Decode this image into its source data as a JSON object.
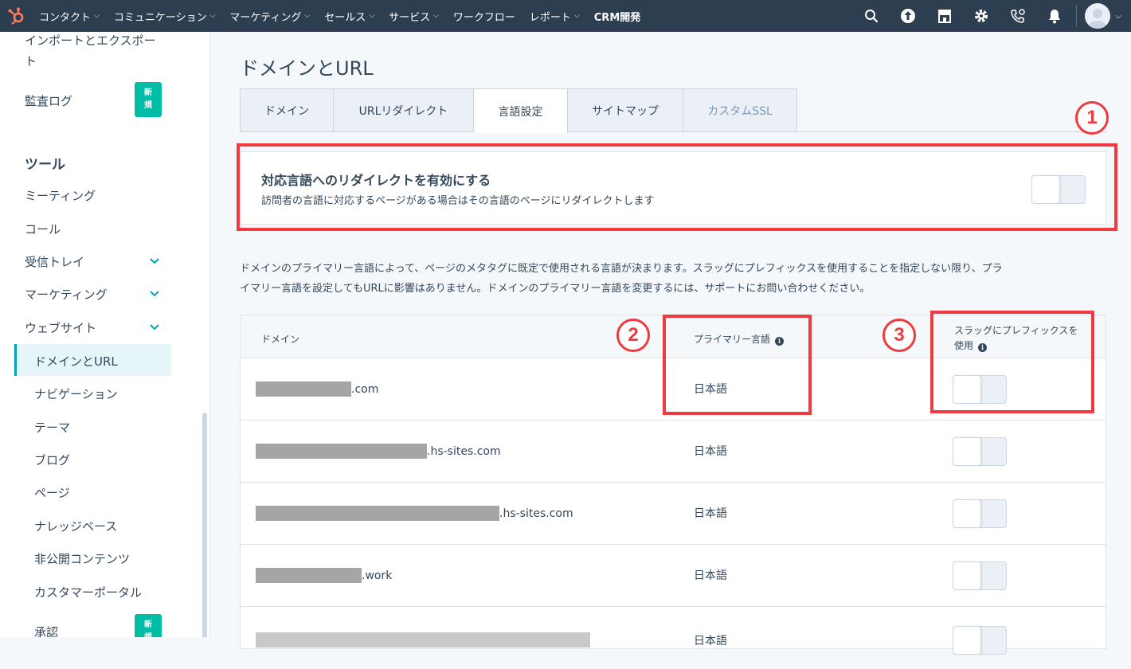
{
  "topnav": {
    "menu": [
      {
        "label": "コンタクト",
        "chevron": true
      },
      {
        "label": "コミュニケーション",
        "chevron": true
      },
      {
        "label": "マーケティング",
        "chevron": true
      },
      {
        "label": "セールス",
        "chevron": true
      },
      {
        "label": "サービス",
        "chevron": true
      },
      {
        "label": "ワークフロー",
        "chevron": false
      },
      {
        "label": "レポート",
        "chevron": true
      }
    ],
    "crm_label": "CRM開発",
    "icons": [
      "search-icon",
      "upgrade-icon",
      "marketplace-icon",
      "settings-icon",
      "calling-icon",
      "notifications-icon"
    ]
  },
  "sidebar": {
    "import_export_line1": "インポートとエクスポー",
    "import_export_line2": "ト",
    "audit_log": "監査ログ",
    "new_badge_1": "新",
    "new_badge_2": "規",
    "tools_heading": "ツール",
    "meetings": "ミーティング",
    "calls": "コール",
    "inbox": "受信トレイ",
    "marketing": "マーケティング",
    "website": "ウェブサイト",
    "domains_urls": "ドメインとURL",
    "navigation": "ナビゲーション",
    "themes": "テーマ",
    "blog": "ブログ",
    "pages": "ページ",
    "knowledge_base": "ナレッジベース",
    "private_content": "非公開コンテンツ",
    "customer_portal": "カスタマーポータル",
    "approvals": "承認"
  },
  "main": {
    "title": "ドメインとURL",
    "tabs": [
      {
        "label": "ドメイン"
      },
      {
        "label": "URLリダイレクト"
      },
      {
        "label": "言語設定"
      },
      {
        "label": "サイトマップ"
      },
      {
        "label": "カスタムSSL"
      }
    ],
    "redirect": {
      "title": "対応言語へのリダイレクトを有効にする",
      "description": "訪問者の言語に対応するページがある場合はその言語のページにリダイレクトします",
      "enabled": false
    },
    "info_line1": "ドメインのプライマリー言語によって、ページのメタタグに既定で使用される言語が決まります。スラッグにプレフィックスを使用することを指定しない限り、プラ",
    "info_line2": "イマリー言語を設定してもURLに影響はありません。ドメインのプライマリー言語を変更するには、サポートにお問い合わせください。",
    "table": {
      "col_domain": "ドメイン",
      "col_primary_language": "プライマリー言語",
      "col_prefix_line1": "スラッグにプレフィックスを",
      "col_prefix_line2": "使用",
      "rows": [
        {
          "domain_suffix": ".com",
          "language": "日本語",
          "prefix_enabled": false
        },
        {
          "domain_suffix": ".hs-sites.com",
          "language": "日本語",
          "prefix_enabled": false
        },
        {
          "domain_suffix": ".hs-sites.com",
          "language": "日本語",
          "prefix_enabled": false
        },
        {
          "domain_suffix": ".work",
          "language": "日本語",
          "prefix_enabled": false
        },
        {
          "domain_suffix": "",
          "language": "日本語",
          "prefix_enabled": false
        }
      ]
    }
  },
  "annotations": {
    "marker_1": "1",
    "marker_2": "2",
    "marker_3": "3",
    "color": "#ef3b3f"
  }
}
